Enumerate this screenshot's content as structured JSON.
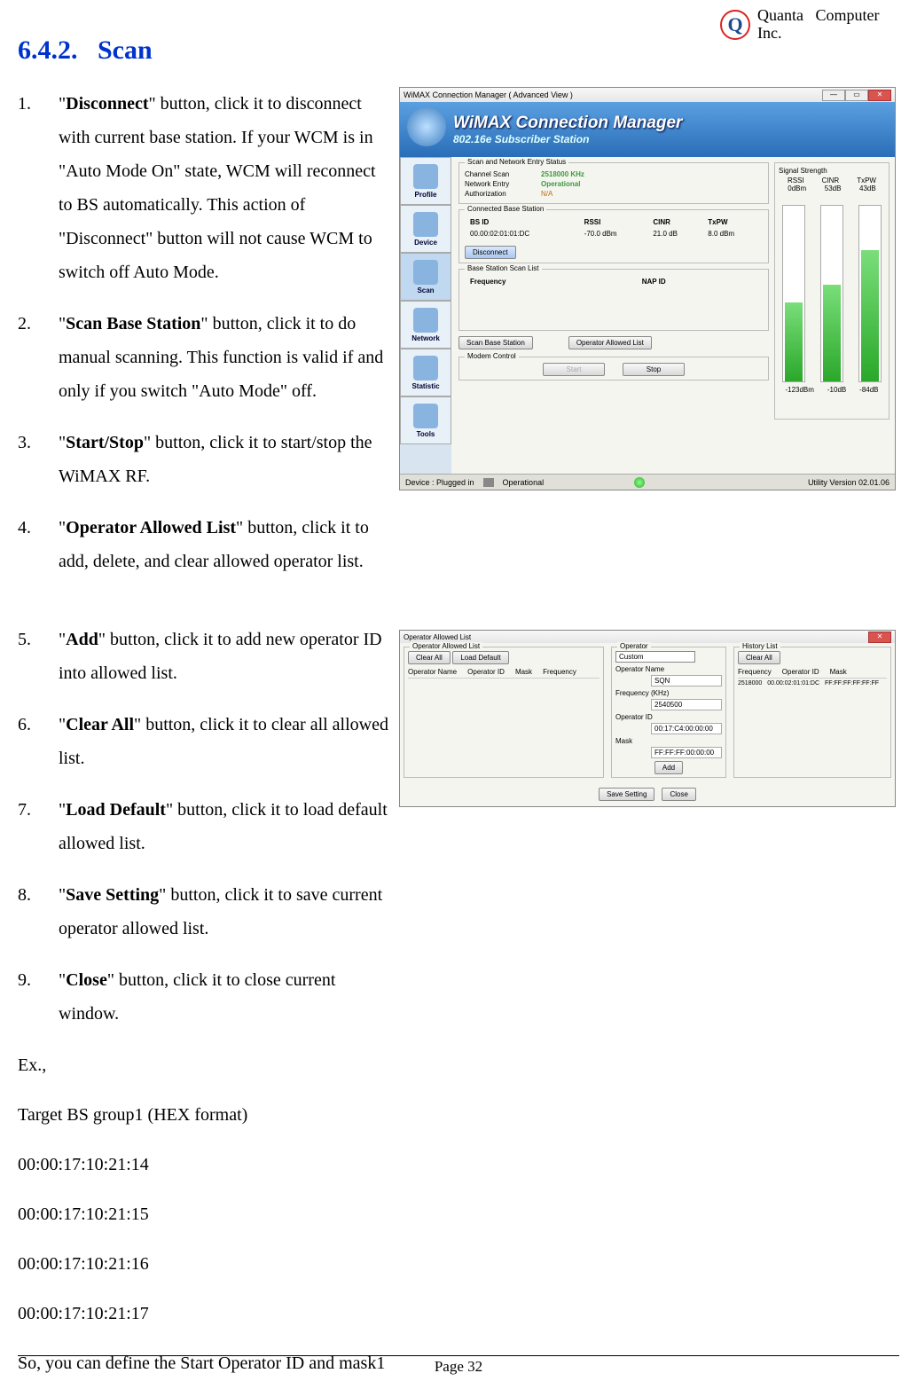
{
  "company_line1": "Quanta",
  "company_line2": "Computer",
  "company_line3": "Inc.",
  "section_number": "6.4.2.",
  "section_title": "Scan",
  "list1": [
    {
      "num": "1.",
      "bold": "Disconnect",
      "rest": "\" button, click it to disconnect with current base station. If your WCM is in \"Auto Mode On\" state, WCM will reconnect to BS automatically. This action of \"Disconnect\" button will not cause WCM to switch off Auto Mode."
    },
    {
      "num": "2.",
      "bold": "Scan Base Station",
      "rest": "\" button, click it to do manual scanning. This function is valid if and only if you switch \"Auto Mode\" off."
    },
    {
      "num": "3.",
      "bold": "Start/Stop",
      "rest": "\" button, click it to start/stop the WiMAX RF."
    },
    {
      "num": "4.",
      "bold": "Operator Allowed List",
      "rest": "\" button, click it to add, delete, and clear allowed operator list."
    }
  ],
  "list2": [
    {
      "num": "5.",
      "bold": "Add",
      "rest": "\" button, click it to add new operator ID into allowed list."
    },
    {
      "num": "6.",
      "bold": "Clear All",
      "rest": "\" button, click it to clear all allowed list."
    },
    {
      "num": "7.",
      "bold": "Load Default",
      "rest": "\" button, click it to load default allowed list."
    },
    {
      "num": "8.",
      "bold": "Save Setting",
      "rest": "\" button, click it to save current operator allowed list."
    },
    {
      "num": "9.",
      "bold": "Close",
      "rest": "\" button, click it to close current window."
    }
  ],
  "ex_label": "Ex.,",
  "target_line": "Target BS group1 (HEX format)",
  "hex1": "00:00:17:10:21:14",
  "hex2": "00:00:17:10:21:15",
  "hex3": "00:00:17:10:21:16",
  "hex4": "00:00:17:10:21:17",
  "so_line": "So, you can define the Start Operator ID and mask1",
  "page_number": "Page 32",
  "ss1": {
    "title": "WiMAX Connection Manager ( Advanced View )",
    "banner_title": "WiMAX Connection Manager",
    "banner_sub": "802.16e Subscriber Station",
    "sidebar": [
      "Profile",
      "Device",
      "Scan",
      "Network",
      "Statistic",
      "Tools"
    ],
    "group_scan_title": "Scan and Network Entry Status",
    "ch_scan_label": "Channel Scan",
    "ch_scan_val": "2518000 KHz",
    "net_entry_label": "Network Entry",
    "net_entry_val": "Operational",
    "auth_label": "Authorization",
    "auth_val": "N/A",
    "group_conn_title": "Connected  Base Station",
    "bs_headers": [
      "BS ID",
      "RSSI",
      "CINR",
      "TxPW"
    ],
    "bs_row": [
      "00.00:02:01:01:DC",
      "-70.0 dBm",
      "21.0 dB",
      "8.0 dBm"
    ],
    "disconnect_btn": "Disconnect",
    "group_scanlist_title": "Base Station Scan List",
    "scanlist_headers": [
      "Frequency",
      "NAP ID"
    ],
    "scan_base_btn": "Scan Base Station",
    "op_allowed_btn": "Operator Allowed List",
    "modem_title": "Modem Control",
    "start_btn": "Start",
    "stop_btn": "Stop",
    "signal_title": "Signal Strength",
    "sig_hdr": [
      "RSSI",
      "CINR",
      "TxPW"
    ],
    "sig_vals": [
      "0dBm",
      "53dB",
      "43dB"
    ],
    "sig_foot": [
      "-123dBm",
      "-10dB",
      "-84dB"
    ],
    "status_device": "Device  :  Plugged in",
    "status_op": "Operational",
    "status_ver": "Utility Version  02.01.06"
  },
  "ss2": {
    "title": "Operator Allowed List",
    "left_group": "Operator Allowed List",
    "clear_all_btn": "Clear All",
    "load_default_btn": "Load Default",
    "left_headers": [
      "Operator Name",
      "Operator ID",
      "Mask",
      "Frequency"
    ],
    "mid_group": "Operator",
    "sel_val": "Custom",
    "opname_label": "Operator Name",
    "opname_val": "SQN",
    "freq_label": "Frequency (KHz)",
    "freq_val": "2540500",
    "opid_label": "Operator ID",
    "opid_val": "00:17:C4:00:00:00",
    "mask_label": "Mask",
    "mask_val": "FF:FF:FF:00:00:00",
    "add_btn": "Add",
    "right_group": "History List",
    "right_headers": [
      "Frequency",
      "Operator ID",
      "Mask"
    ],
    "right_row": [
      "2518000",
      "00.00:02:01:01:DC",
      "FF:FF:FF:FF:FF:FF"
    ],
    "save_btn": "Save Setting",
    "close_btn": "Close"
  }
}
